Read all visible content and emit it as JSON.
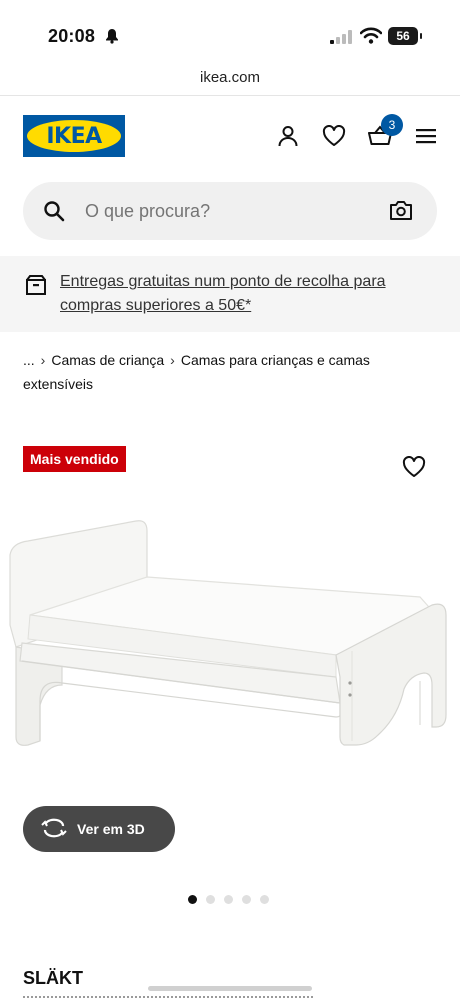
{
  "status_bar": {
    "time": "20:08",
    "battery": "56"
  },
  "browser": {
    "url": "ikea.com"
  },
  "header": {
    "logo_text": "IKEA",
    "cart_count": "3",
    "icons": [
      "user-icon",
      "heart-icon",
      "basket-icon",
      "menu-icon"
    ]
  },
  "search": {
    "placeholder": "O que procura?"
  },
  "promo": {
    "text": "Entregas gratuitas num ponto de recolha para compras superiores a 50€*"
  },
  "breadcrumb": {
    "ellipsis": "...",
    "items": [
      "Camas de criança",
      "Camas para crianças e camas extensíveis"
    ]
  },
  "product": {
    "badge": "Mais vendido",
    "view_3d_label": "Ver em 3D",
    "name": "SLÄKT",
    "carousel": {
      "total": 5,
      "active": 1
    }
  },
  "colors": {
    "brand_blue": "#0058a3",
    "brand_yellow": "#ffdb00",
    "badge_red": "#cc0008",
    "button_dark": "#484848"
  }
}
